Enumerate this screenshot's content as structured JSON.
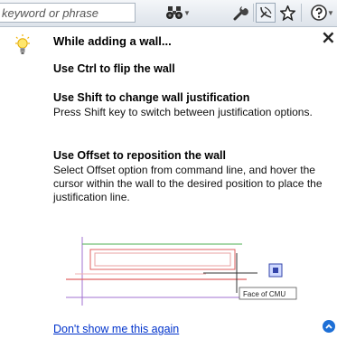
{
  "toolbar": {
    "search_placeholder": "keyword or phrase",
    "icons": [
      "binoculars-icon",
      "wrench-icon",
      "satellite-icon",
      "star-icon",
      "help-icon"
    ]
  },
  "tooltip": {
    "title": "While adding a wall...",
    "tip1_heading": "Use Ctrl to flip the wall",
    "tip2_heading": "Use Shift to change wall justification",
    "tip2_text": "Press Shift key to switch between justification options.",
    "tip3_heading": "Use Offset to reposition the wall",
    "tip3_text": "Select Offset option from command line, and hover the cursor within the wall to the desired position to place the justification line.",
    "figure_label": "Face of CMU",
    "dont_show_link": "Don't show me this again"
  },
  "colors": {
    "link": "#0033cc",
    "wall_red": "#e06060",
    "guide_green": "#4caf50",
    "guide_purple": "#a070d0",
    "accent_blue": "#1d6fd6"
  }
}
